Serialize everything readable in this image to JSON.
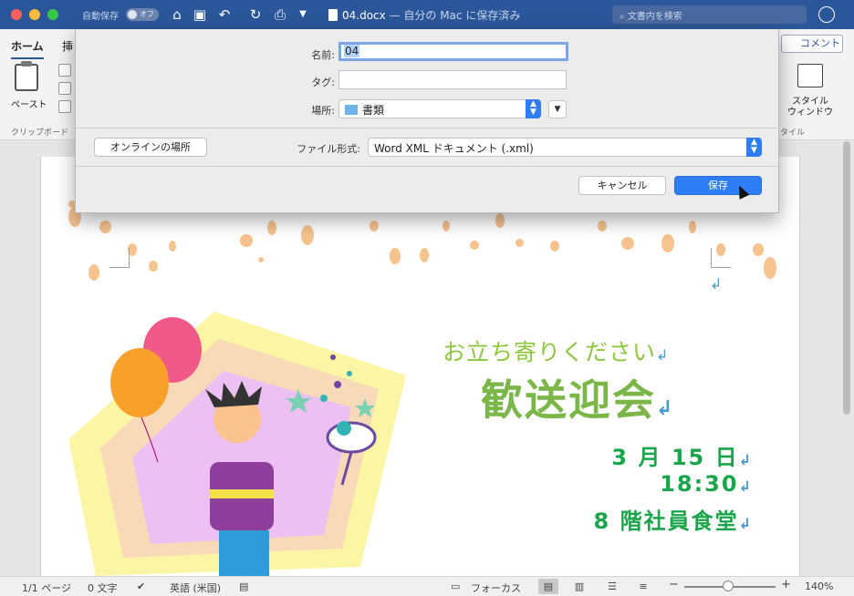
{
  "titlebar": {
    "autosave_label": "自動保存",
    "autosave_toggle": "オフ",
    "doc_name": "04.docx",
    "doc_status": " — 自分の Mac に保存済み",
    "search_placeholder": "文書内を検索"
  },
  "ribbon": {
    "tab_home": "ホーム",
    "tab_insert": "挿",
    "comment_button": "コメント",
    "paste_label": "ペースト",
    "clipboard_group": "クリップボード",
    "style_pane_label": "スタイル\nウィンドウ",
    "style_group": "タイル"
  },
  "dialog": {
    "name_label": "名前:",
    "name_value": "04",
    "tags_label": "タグ:",
    "tags_value": "",
    "where_label": "場所:",
    "where_value": "書類",
    "online_button": "オンラインの場所",
    "format_label": "ファイル形式:",
    "format_value": "Word XML ドキュメント (.xml)",
    "cancel_button": "キャンセル",
    "save_button": "保存"
  },
  "document": {
    "invite": "お立ち寄りください",
    "title": "歓送迎会",
    "date": "3 月 15 日",
    "time": "18:30",
    "place": "8 階社員食堂",
    "para_mark": "↲"
  },
  "statusbar": {
    "page": "1/1 ページ",
    "words": "0 文字",
    "language": "英語 (米国)",
    "focus": "フォーカス",
    "zoom": "140%",
    "zoom_level": 0.48
  }
}
